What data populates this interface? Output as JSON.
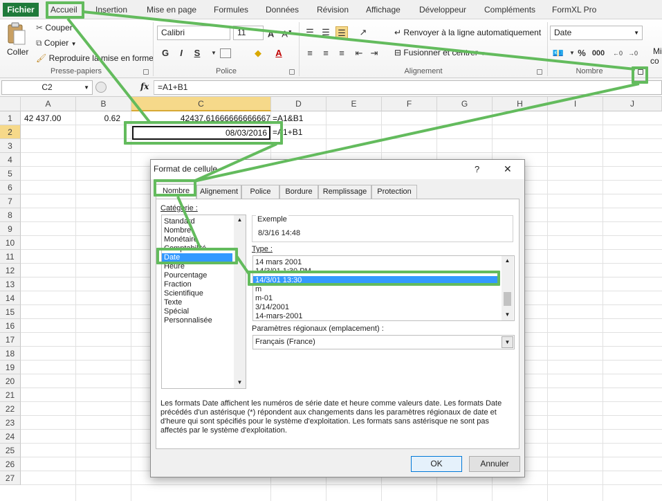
{
  "ribbon_tabs": [
    "Fichier",
    "Accueil",
    "Insertion",
    "Mise en page",
    "Formules",
    "Données",
    "Révision",
    "Affichage",
    "Développeur",
    "Compléments",
    "FormXL Pro"
  ],
  "clipboard": {
    "paste": "Coller",
    "cut": "Couper",
    "copy": "Copier",
    "format_painter": "Reproduire la mise en forme",
    "label": "Presse-papiers"
  },
  "font": {
    "name": "Calibri",
    "size": "11",
    "bold": "G",
    "italic": "I",
    "underline": "S",
    "label": "Police"
  },
  "alignment": {
    "wrap": "Renvoyer à la ligne automatiquement",
    "merge": "Fusionner et centrer",
    "label": "Alignement"
  },
  "number": {
    "format": "Date",
    "percent": "%",
    "thousands": "000",
    "label": "Nombre",
    "truncated": "Mi",
    "truncated2": "co"
  },
  "formula_bar": {
    "name_box": "C2",
    "fx": "fx",
    "formula": "=A1+B1"
  },
  "grid": {
    "columns": [
      "A",
      "B",
      "C",
      "D",
      "E",
      "F",
      "G",
      "H",
      "I",
      "J"
    ],
    "rows": [
      "1",
      "2",
      "3",
      "4",
      "5",
      "6",
      "7",
      "8",
      "9",
      "10",
      "11",
      "12",
      "13",
      "14",
      "15",
      "16",
      "17",
      "18",
      "19",
      "20",
      "21",
      "22",
      "23",
      "24",
      "25",
      "26",
      "27"
    ],
    "cells": {
      "A1": "42 437.00",
      "B1": "0.62",
      "C1": "42437.61666666666667",
      "D1": "=A1&B1",
      "C2": "08/03/2016",
      "D2": "=A1+B1"
    }
  },
  "dialog": {
    "title": "Format de cellule",
    "help": "?",
    "close": "✕",
    "tabs": [
      "Nombre",
      "Alignement",
      "Police",
      "Bordure",
      "Remplissage",
      "Protection"
    ],
    "category_label": "Catégorie :",
    "categories": [
      "Standard",
      "Nombre",
      "Monétaire",
      "Comptabilité",
      "Date",
      "Heure",
      "Pourcentage",
      "Fraction",
      "Scientifique",
      "Texte",
      "Spécial",
      "Personnalisée"
    ],
    "selected_category": "Date",
    "sample_label": "Exemple",
    "sample_value": "8/3/16 14:48",
    "type_label": "Type :",
    "types": [
      "14 mars 2001",
      "14/3/01 1:30 PM",
      "14/3/01 13:30",
      "m",
      "m-01",
      "3/14/2001",
      "14-mars-2001"
    ],
    "selected_type": "14/3/01 13:30",
    "locale_label": "Paramètres régionaux (emplacement) :",
    "locale_value": "Français (France)",
    "description": "Les formats Date affichent les numéros de série date et heure comme valeurs date. Les formats Date précédés d'un astérisque (*) répondent aux changements dans les paramètres régionaux de date et d'heure qui sont spécifiés pour le système d'exploitation. Les formats sans astérisque ne sont pas affectés par le système d'exploitation.",
    "ok": "OK",
    "cancel": "Annuler"
  },
  "colors": {
    "file_tab": "#1f7a3a",
    "highlight": "#63bb5d",
    "selection": "#3399ff"
  }
}
